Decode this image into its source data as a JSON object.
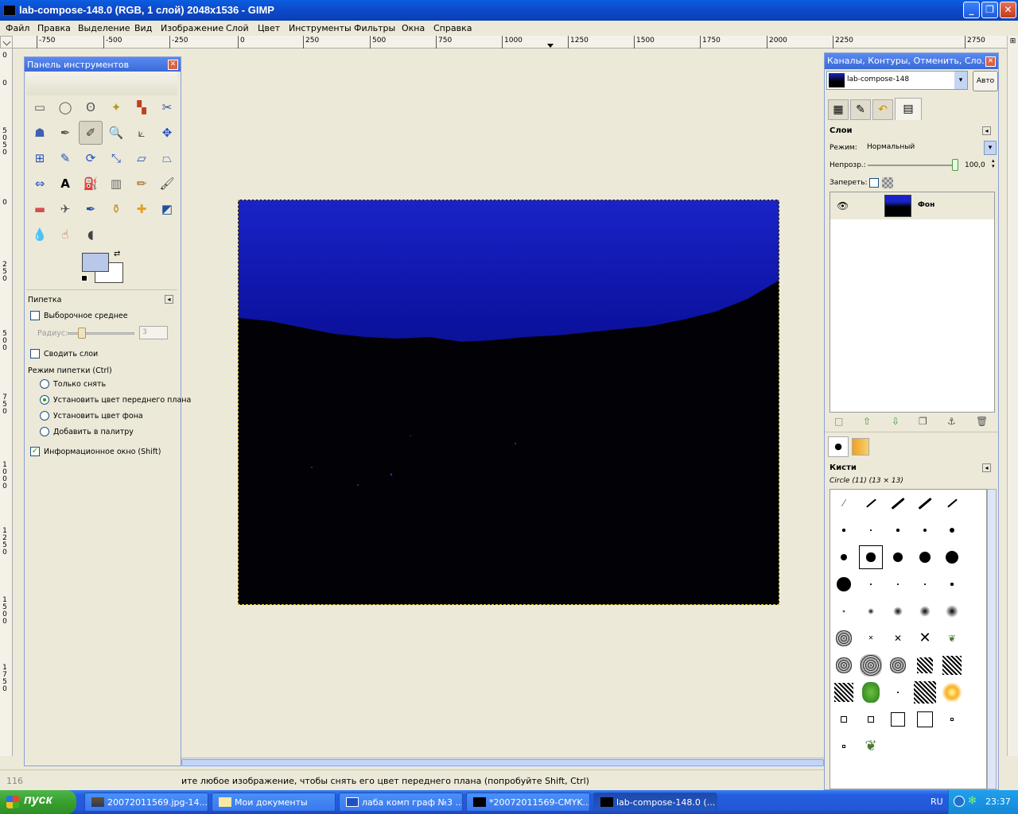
{
  "window": {
    "title": "lab-compose-148.0 (RGB, 1 слой) 2048x1536 - GIMP",
    "minimize": "_",
    "maximize": "❐",
    "close": "✕"
  },
  "menu": [
    "Файл",
    "Правка",
    "Выделение",
    "Вид",
    "Изображение",
    "Слой",
    "Цвет",
    "Инструменты",
    "Фильтры",
    "Окна",
    "Справка"
  ],
  "ruler_top": [
    "-750",
    "-500",
    "-250",
    "0",
    "250",
    "500",
    "750",
    "1000",
    "1250",
    "1500",
    "1750",
    "2000",
    "2250",
    "2750"
  ],
  "ruler_left": [
    "0",
    "0",
    "5",
    "0",
    "5",
    "0",
    "0",
    "2",
    "5",
    "0",
    "5",
    "0",
    "0",
    "7",
    "5",
    "0",
    "1",
    "0",
    "0",
    "0",
    "1",
    "2",
    "5",
    "0",
    "1",
    "5",
    "0",
    "0",
    "1",
    "7",
    "5",
    "0"
  ],
  "toolbox": {
    "title": "Панель инструментов",
    "tool_icons": [
      "rect-select-icon",
      "ellipse-select-icon",
      "free-select-icon",
      "fuzzy-select-icon",
      "by-color-select-icon",
      "scissors-icon",
      "foreground-select-icon",
      "paths-icon",
      "color-picker-icon",
      "zoom-icon",
      "measure-icon",
      "move-icon",
      "align-icon",
      "crop-icon",
      "rotate-icon",
      "scale-icon",
      "shear-icon",
      "perspective-icon",
      "flip-icon",
      "text-icon",
      "bucket-fill-icon",
      "blend-icon",
      "pencil-icon",
      "paintbrush-icon",
      "eraser-icon",
      "airbrush-icon",
      "ink-icon",
      "clone-icon",
      "heal-icon",
      "perspective-clone-icon",
      "blur-icon",
      "smudge-icon",
      "dodge-burn-icon"
    ],
    "fg_color": "#b8c8e8",
    "bg_color": "#ffffff"
  },
  "tool_options": {
    "title": "Пипетка",
    "sample_average": "Выборочное среднее",
    "radius_label": "Радиус:",
    "radius_value": "3",
    "sample_merged": "Сводить слои",
    "mode_label": "Режим пипетки  (Ctrl)",
    "modes": [
      "Только снять",
      "Установить цвет переднего плана",
      "Установить цвет фона",
      "Добавить в палитру"
    ],
    "selected_mode": 1,
    "info_window": "Информационное окно  (Shift)"
  },
  "status": {
    "unit": "116",
    "text": "ите любое изображение, чтобы снять его цвет переднего плана (попробуйте Shift, Ctrl)"
  },
  "dock": {
    "title": "Каналы, Контуры, Отменить, Сло...",
    "image_name": "lab-compose-148",
    "auto_button": "Авто",
    "layers": {
      "title": "Слои",
      "mode_label": "Режим:",
      "mode_value": "Нормальный",
      "opacity_label": "Непрозр.:",
      "opacity_value": "100,0",
      "lock_label": "Запереть:",
      "items": [
        {
          "name": "Фон"
        }
      ]
    },
    "brushes": {
      "title": "Кисти",
      "selected": "Circle (11) (13 × 13)"
    }
  },
  "taskbar": {
    "start": "пуск",
    "tasks": [
      "20072011569.jpg-14...",
      "Мои документы",
      "лаба комп граф №3 ...",
      "*20072011569-CMYK...",
      "lab-compose-148.0 (..."
    ],
    "lang": "RU",
    "time": "23:37"
  }
}
